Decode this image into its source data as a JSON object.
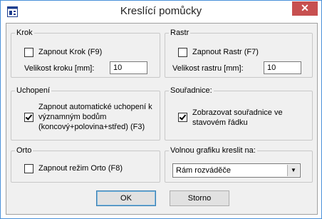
{
  "window": {
    "title": "Kreslící pomůcky",
    "close_glyph": "✕"
  },
  "krok": {
    "legend": "Krok",
    "checkbox_label": "Zapnout Krok (F9)",
    "checked": false,
    "size_label": "Velikost kroku [mm]:",
    "size_value": "10"
  },
  "rastr": {
    "legend": "Rastr",
    "checkbox_label": "Zapnout Rastr (F7)",
    "checked": false,
    "size_label": "Velikost rastru [mm]:",
    "size_value": "10"
  },
  "uchopeni": {
    "legend": "Uchopení",
    "checkbox_label_lines": [
      "Zapnout automatické uchopení k",
      "významným bodům",
      "(koncový+polovina+střed) (F3)"
    ],
    "checked": true
  },
  "souradnice": {
    "legend": "Souřadnice:",
    "checkbox_label_lines": [
      "Zobrazovat souřadnice ve",
      "stavovém řádku"
    ],
    "checked": true
  },
  "orto": {
    "legend": "Orto",
    "checkbox_label": "Zapnout režim Orto (F8)",
    "checked": false
  },
  "volna_grafika": {
    "legend": "Volnou grafiku kreslit na:",
    "selected": "Rám rozváděče"
  },
  "buttons": {
    "ok": "OK",
    "cancel": "Storno"
  },
  "icons": {
    "app": "app-window-icon",
    "close": "close-icon",
    "dropdown": "chevron-down-icon"
  }
}
